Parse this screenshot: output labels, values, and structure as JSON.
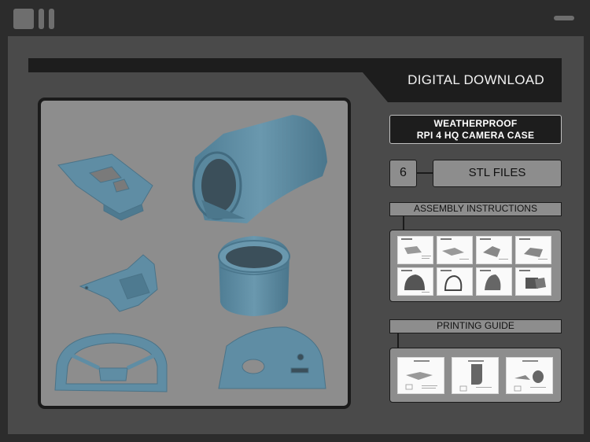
{
  "window": {
    "icons": [
      "app-square-icon",
      "app-bar-icon",
      "app-bar-icon",
      "window-control-icon"
    ]
  },
  "banner": {
    "title": "DIGITAL DOWNLOAD"
  },
  "product": {
    "title_line1": "WEATHERPROOF",
    "title_line2": "RPI 4 HQ CAMERA CASE"
  },
  "files": {
    "count": "6",
    "label": "STL FILES"
  },
  "assembly": {
    "label": "ASSEMBLY INSTRUCTIONS",
    "page_count": 8
  },
  "printing": {
    "label": "PRINTING GUIDE",
    "page_count": 3
  },
  "colors": {
    "frame": "#2c2c2c",
    "panel": "#4a4a4a",
    "box_gray": "#8d8d8d",
    "outline": "#1b1b1b",
    "part_blue": "#5f8da4"
  }
}
